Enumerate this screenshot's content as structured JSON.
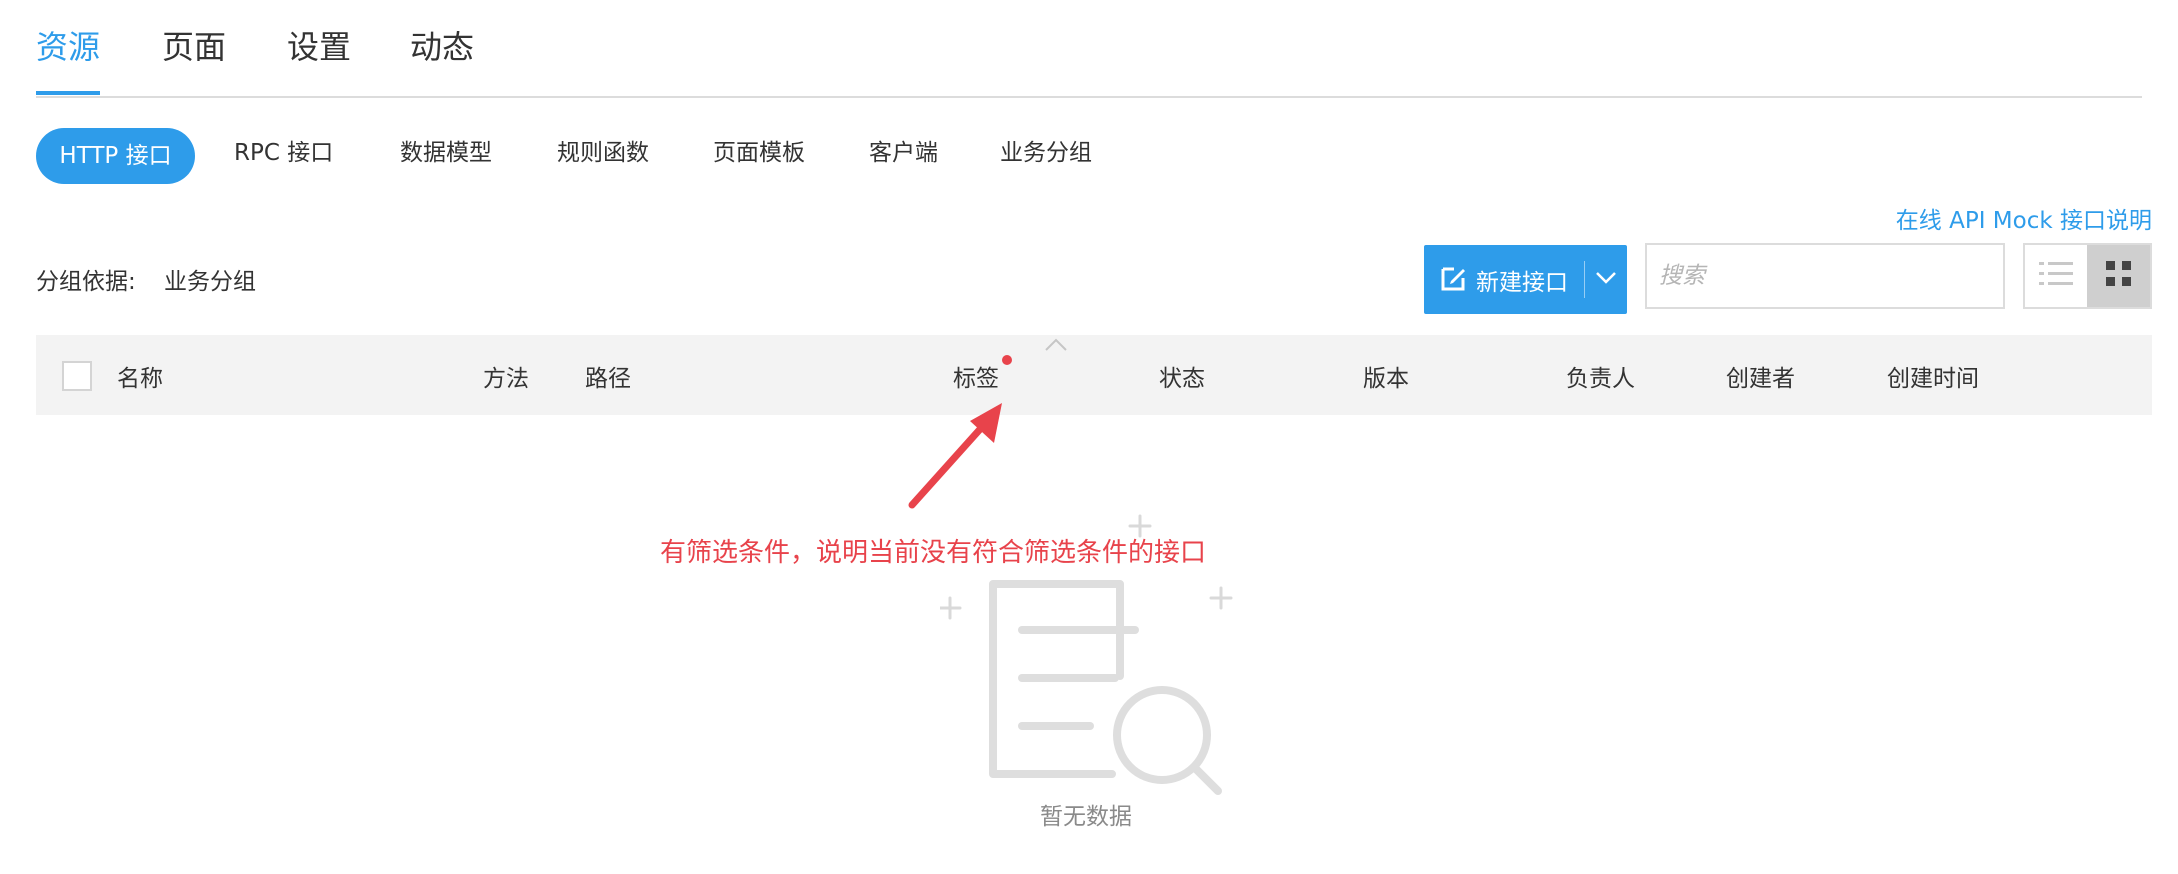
{
  "top_tabs": {
    "resources": "资源",
    "pages": "页面",
    "settings": "设置",
    "activity": "动态"
  },
  "sub_tabs": {
    "http": "HTTP 接口",
    "rpc": "RPC 接口",
    "data_model": "数据模型",
    "rule_func": "规则函数",
    "page_template": "页面模板",
    "client": "客户端",
    "biz_group": "业务分组"
  },
  "mock_link": "在线 API Mock 接口说明",
  "group": {
    "label": "分组依据:",
    "value": "业务分组"
  },
  "toolbar": {
    "new_label": "新建接口",
    "search_placeholder": "搜索"
  },
  "table": {
    "columns": {
      "name": "名称",
      "method": "方法",
      "path": "路径",
      "tags": "标签",
      "status": "状态",
      "version": "版本",
      "owner": "负责人",
      "creator": "创建者",
      "created_at": "创建时间"
    }
  },
  "annotation": "有筛选条件，说明当前没有符合筛选条件的接口",
  "empty": {
    "text": "暂无数据"
  },
  "colors": {
    "accent": "#2e9cea",
    "annotation": "#e8434b"
  }
}
